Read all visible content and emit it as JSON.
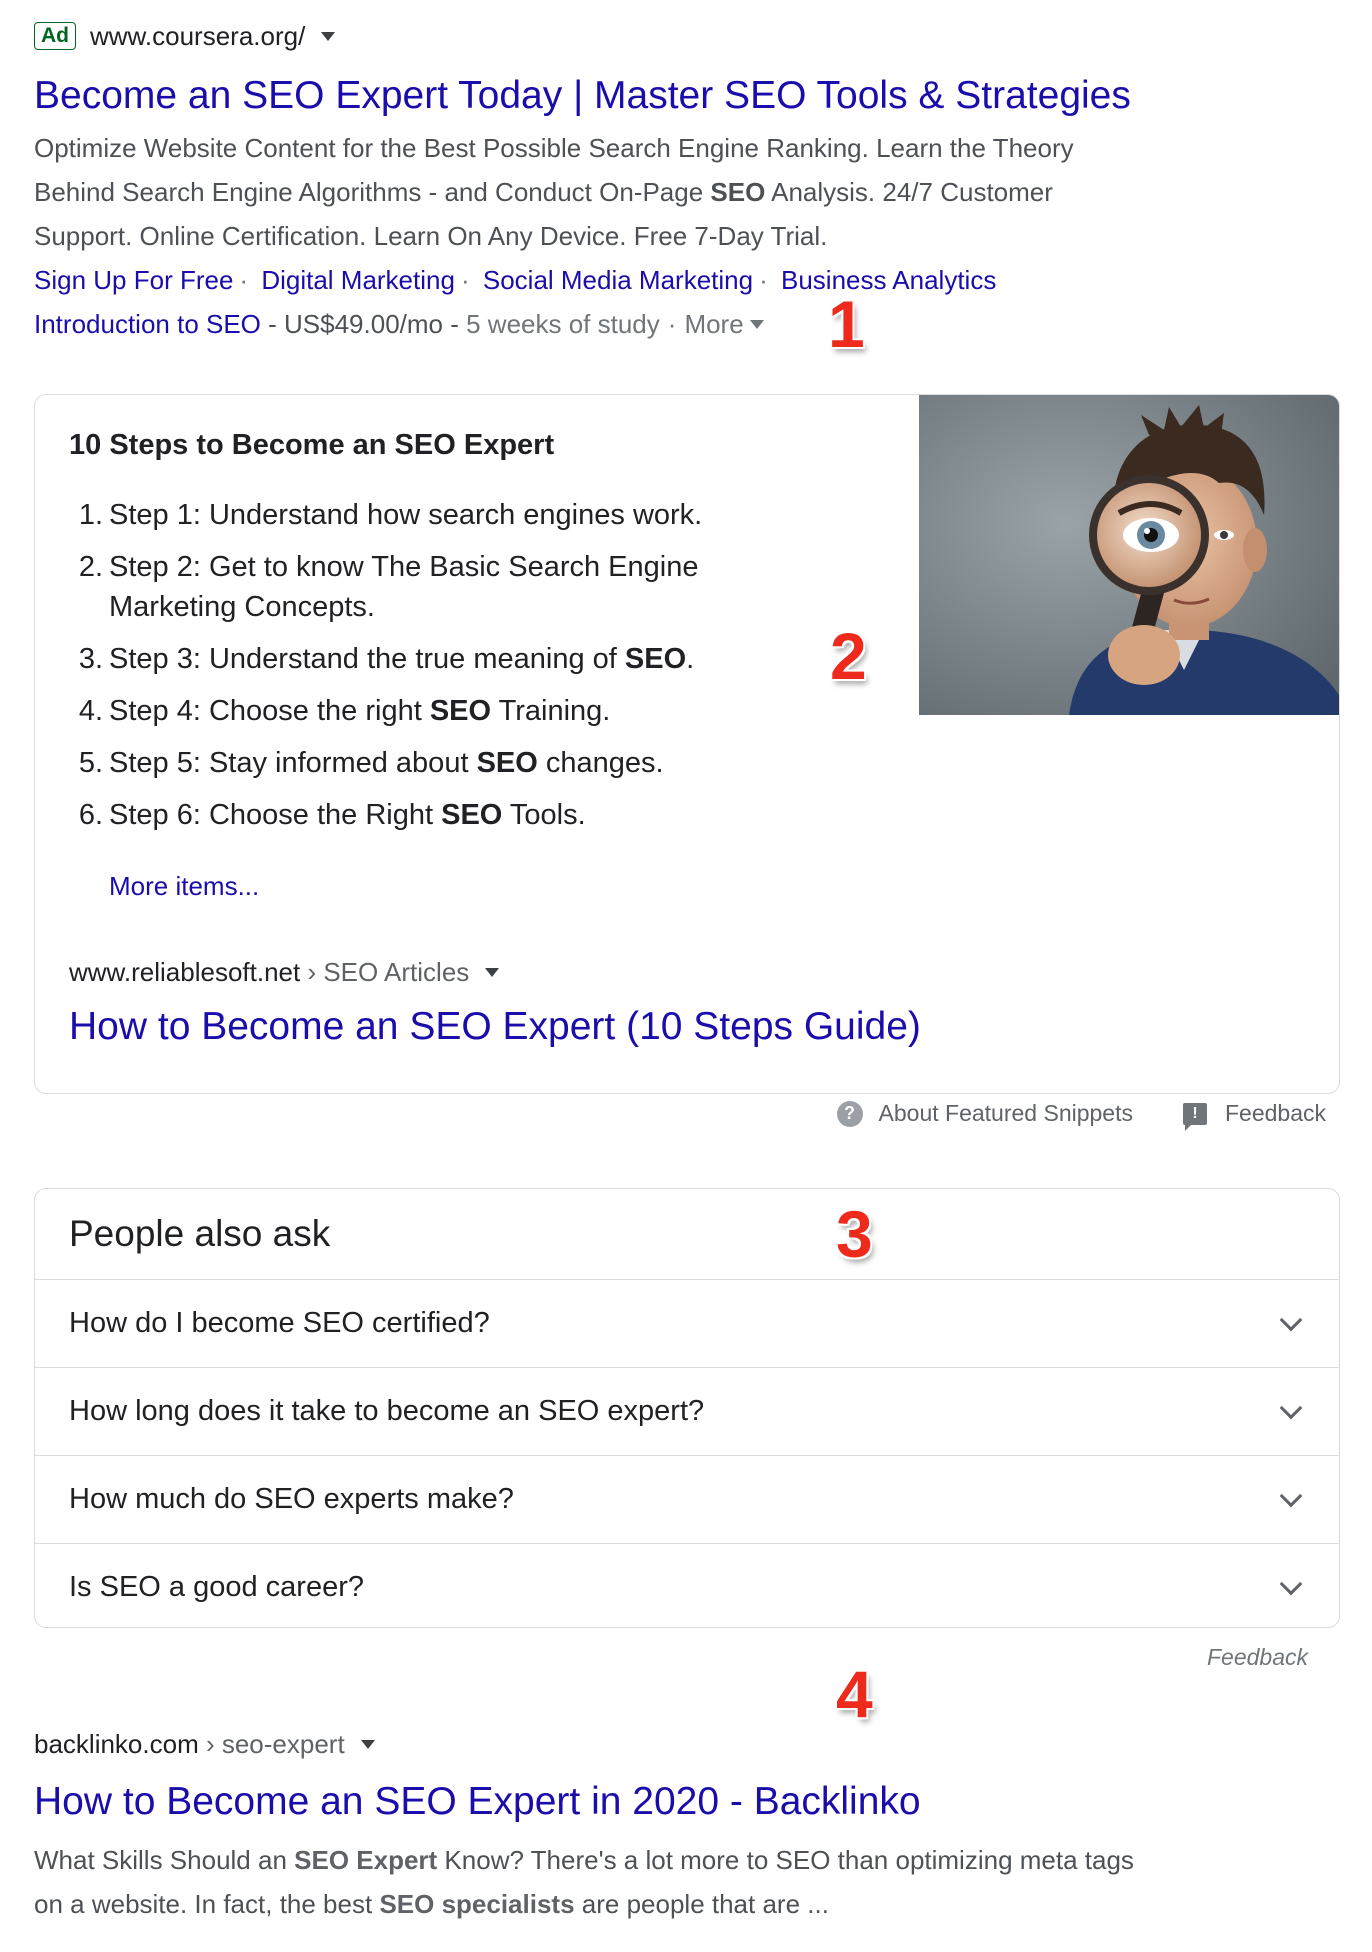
{
  "ad": {
    "badge": "Ad",
    "url": "www.coursera.org/",
    "title": "Become an SEO Expert Today | Master SEO Tools & Strategies",
    "desc_1": "Optimize Website Content for the Best Possible Search Engine Ranking. Learn the Theory",
    "desc_2a": "Behind Search Engine Algorithms - and Conduct On-Page ",
    "desc_2b": "SEO",
    "desc_2c": " Analysis. 24/7 Customer",
    "desc_3": "Support. Online Certification. Learn On Any Device. Free 7-Day Trial.",
    "sitelinks": [
      "Sign Up For Free",
      "Digital Marketing",
      "Social Media Marketing",
      "Business Analytics"
    ],
    "extension_link": "Introduction to SEO",
    "extension_price": " - US$49.00/mo - ",
    "extension_detail": "5 weeks of study",
    "more": "More"
  },
  "markers": [
    "1",
    "2",
    "3",
    "4"
  ],
  "snippet": {
    "title": "10 Steps to Become an SEO Expert",
    "steps": [
      {
        "num": "1.",
        "pre": "Step 1: Understand how search engines work.",
        "bold": "",
        "post": ""
      },
      {
        "num": "2.",
        "pre": "Step 2: Get to know The Basic Search Engine Marketing Concepts.",
        "bold": "",
        "post": ""
      },
      {
        "num": "3.",
        "pre": "Step 3: Understand the true meaning of ",
        "bold": "SEO",
        "post": "."
      },
      {
        "num": "4.",
        "pre": "Step 4: Choose the right ",
        "bold": "SEO",
        "post": " Training."
      },
      {
        "num": "5.",
        "pre": "Step 5: Stay informed about ",
        "bold": "SEO",
        "post": " changes."
      },
      {
        "num": "6.",
        "pre": "Step 6: Choose the Right ",
        "bold": "SEO",
        "post": " Tools."
      }
    ],
    "more_items": "More items...",
    "cite_domain": "www.reliablesoft.net",
    "cite_path": " › SEO Articles",
    "link_title": "How to Become an SEO Expert (10 Steps Guide)",
    "about": "About Featured Snippets",
    "feedback": "Feedback"
  },
  "paa": {
    "title": "People also ask",
    "questions": [
      "How do I become SEO certified?",
      "How long does it take to become an SEO expert?",
      "How much do SEO experts make?",
      "Is SEO a good career?"
    ],
    "feedback": "Feedback"
  },
  "organic": {
    "cite_domain": "backlinko.com",
    "cite_path": " › seo-expert",
    "title": "How to Become an SEO Expert in 2020 - Backlinko",
    "d1a": "What Skills Should an ",
    "d1b": "SEO Expert",
    "d1c": " Know? There's a lot more to SEO than optimizing meta tags",
    "d2a": "on a website. In fact, the best ",
    "d2b": "SEO specialists",
    "d2c": " are people that are ..."
  },
  "colors": {
    "link": "#1a0dab",
    "ad_green": "#006621",
    "marker_red": "#ee2a1c",
    "border": "#dadce0"
  }
}
